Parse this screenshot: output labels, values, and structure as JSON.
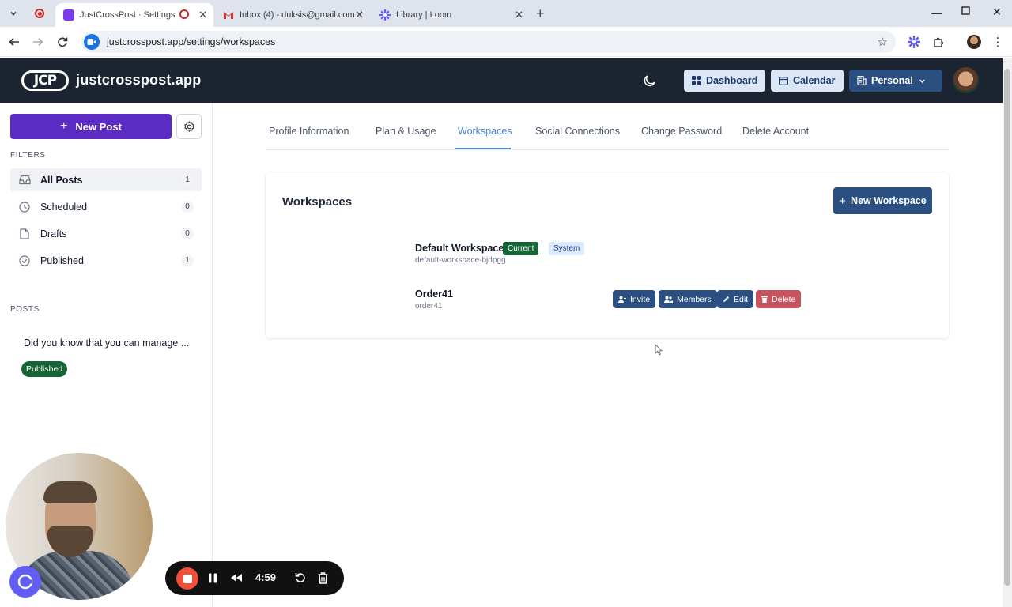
{
  "browser": {
    "tabs": [
      {
        "title": "JustCrossPost · Settings",
        "active": true
      },
      {
        "title": "Inbox (4) - duksis@gmail.com",
        "active": false
      },
      {
        "title": "Library | Loom",
        "active": false
      }
    ],
    "url": "justcrosspost.app/settings/workspaces"
  },
  "header": {
    "logo_text": "JCP",
    "brand": "justcrosspost.app",
    "dashboard_label": "Dashboard",
    "calendar_label": "Calendar",
    "workspace_switch_label": "Personal"
  },
  "sidebar": {
    "new_post_label": "New Post",
    "filters_heading": "FILTERS",
    "filters": [
      {
        "label": "All Posts",
        "count": "1",
        "icon": "inbox-icon",
        "active": true
      },
      {
        "label": "Scheduled",
        "count": "0",
        "icon": "clock-icon",
        "active": false
      },
      {
        "label": "Drafts",
        "count": "0",
        "icon": "file-icon",
        "active": false
      },
      {
        "label": "Published",
        "count": "1",
        "icon": "check-circle-icon",
        "active": false
      }
    ],
    "posts_heading": "POSTS",
    "posts": [
      {
        "title": "Did you know that you can manage ...",
        "status": "Published"
      }
    ]
  },
  "settings_tabs": [
    {
      "label": "Profile Information"
    },
    {
      "label": "Plan & Usage"
    },
    {
      "label": "Workspaces",
      "active": true
    },
    {
      "label": "Social Connections"
    },
    {
      "label": "Change Password"
    },
    {
      "label": "Delete Account"
    }
  ],
  "workspaces": {
    "title": "Workspaces",
    "new_workspace_label": "New Workspace",
    "items": [
      {
        "name": "Default Workspace",
        "slug": "default-workspace-bjdpgg",
        "badges": [
          "Current",
          "System"
        ]
      },
      {
        "name": "Order41",
        "slug": "order41",
        "actions": [
          "Invite",
          "Members",
          "Edit",
          "Delete"
        ]
      }
    ]
  },
  "recorder": {
    "time": "4:59"
  },
  "colors": {
    "header_bg": "#1b2430",
    "primary_purple": "#5b2bc4",
    "primary_navy": "#2c4f82",
    "active_tab": "#4a86d6",
    "badge_green": "#166534",
    "danger": "#c4555f",
    "loom_purple": "#625df5",
    "record_red": "#f14f3a"
  }
}
